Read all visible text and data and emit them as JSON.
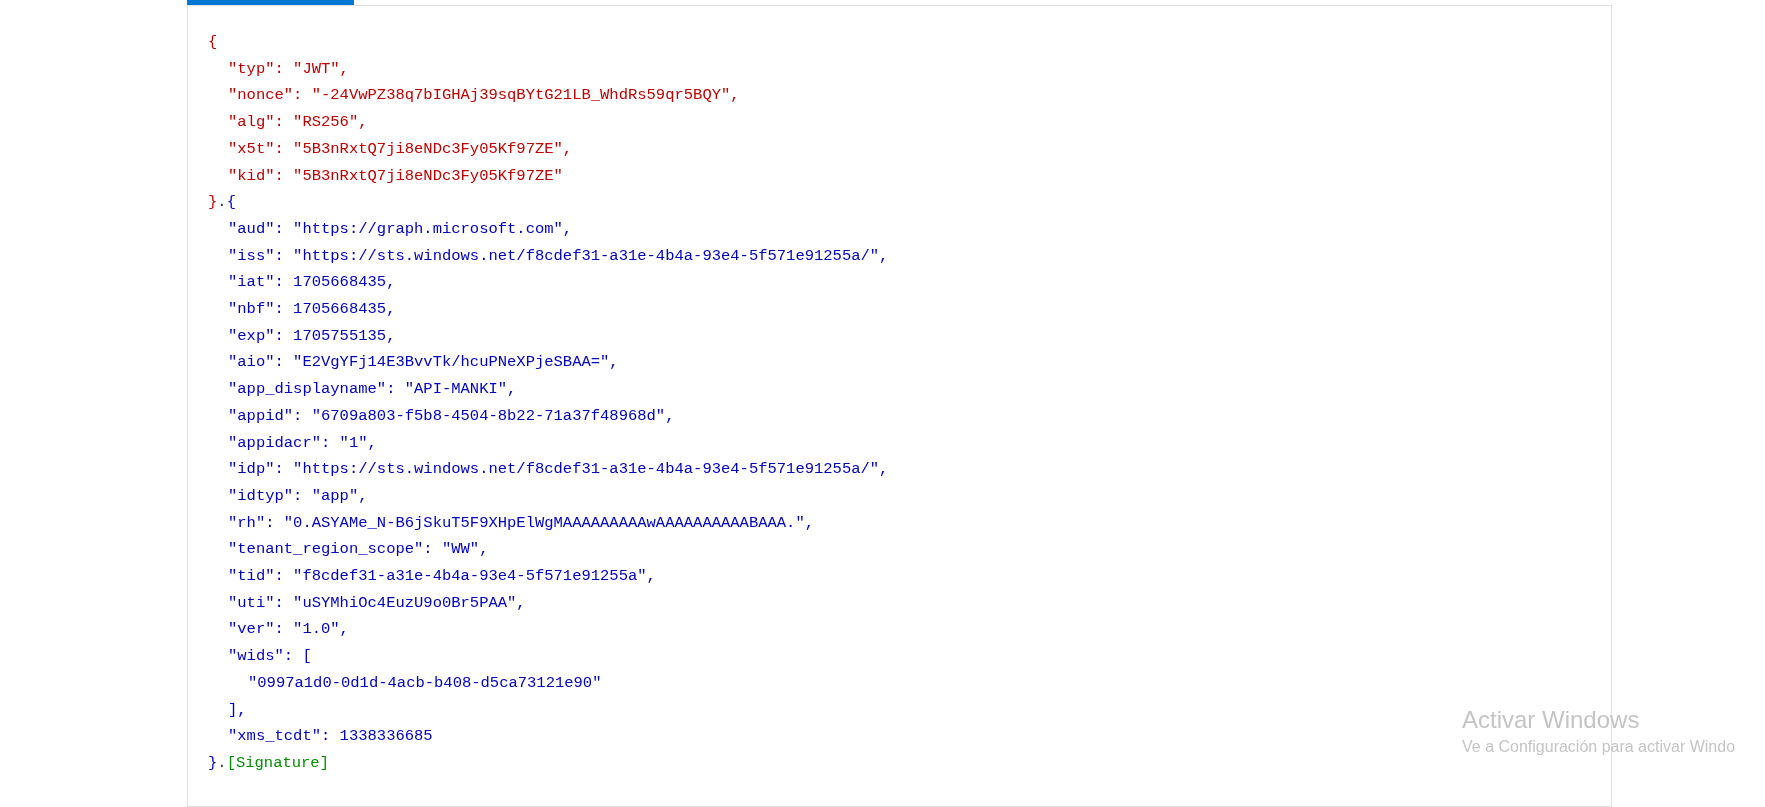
{
  "tab_indicator": {
    "selected": true
  },
  "decoded_token": {
    "header": {
      "open": "{",
      "close": "}",
      "lines": [
        {
          "text": "\"typ\": \"JWT\","
        },
        {
          "text": "\"nonce\": \"-24VwPZ38q7bIGHAj39sqBYtG21LB_WhdRs59qr5BQY\","
        },
        {
          "text": "\"alg\": \"RS256\","
        },
        {
          "text": "\"x5t\": \"5B3nRxtQ7ji8eNDc3Fy05Kf97ZE\","
        },
        {
          "text": "\"kid\": \"5B3nRxtQ7ji8eNDc3Fy05Kf97ZE\""
        }
      ]
    },
    "separator_1": ".",
    "payload": {
      "open": "{",
      "close": "}",
      "lines": [
        {
          "text": "\"aud\": \"https://graph.microsoft.com\","
        },
        {
          "text": "\"iss\": \"https://sts.windows.net/f8cdef31-a31e-4b4a-93e4-5f571e91255a/\","
        },
        {
          "text": "\"iat\": 1705668435,"
        },
        {
          "text": "\"nbf\": 1705668435,"
        },
        {
          "text": "\"exp\": 1705755135,"
        },
        {
          "text": "\"aio\": \"E2VgYFj14E3BvvTk/hcuPNeXPjeSBAA=\","
        },
        {
          "text": "\"app_displayname\": \"API-MANKI\","
        },
        {
          "text": "\"appid\": \"6709a803-f5b8-4504-8b22-71a37f48968d\","
        },
        {
          "text": "\"appidacr\": \"1\","
        },
        {
          "text": "\"idp\": \"https://sts.windows.net/f8cdef31-a31e-4b4a-93e4-5f571e91255a/\","
        },
        {
          "text": "\"idtyp\": \"app\","
        },
        {
          "text": "\"rh\": \"0.ASYAMe_N-B6jSkuT5F9XHpElWgMAAAAAAAAAwAAAAAAAAAABAAA.\","
        },
        {
          "text": "\"tenant_region_scope\": \"WW\","
        },
        {
          "text": "\"tid\": \"f8cdef31-a31e-4b4a-93e4-5f571e91255a\","
        },
        {
          "text": "\"uti\": \"uSYMhiOc4EuzU9o0Br5PAA\","
        },
        {
          "text": "\"ver\": \"1.0\","
        },
        {
          "text": "\"wids\": [",
          "children": [
            {
              "text": "\"0997a1d0-0d1d-4acb-b408-d5ca73121e90\""
            }
          ]
        },
        {
          "text": "],"
        },
        {
          "text": "\"xms_tcdt\": 1338336685"
        }
      ]
    },
    "separator_2": ".",
    "signature": "[Signature]"
  },
  "activation_notice": {
    "title": "Activar Windows",
    "message": "Ve a Configuración para activar Windo"
  }
}
